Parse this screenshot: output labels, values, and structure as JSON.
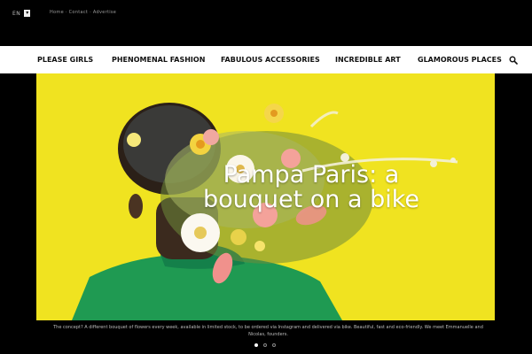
{
  "topbar": {
    "language": "EN",
    "language_toggle": "▾",
    "links": "Home · Contact · Advertise"
  },
  "nav": {
    "items": [
      {
        "label": "PLEASE GIRLS"
      },
      {
        "label": "PHENOMENAL FASHION"
      },
      {
        "label": "FABULOUS ACCESSORIES"
      },
      {
        "label": "INCREDIBLE ART"
      },
      {
        "label": "GLAMOROUS PLACES"
      }
    ],
    "search_icon": "search-icon"
  },
  "hero": {
    "title": "Pampa Paris: a bouquet on a bike",
    "caption": "The concept? A different bouquet of flowers every week, available in limited stock, to be ordered via Instagram and delivered via bike. Beautiful, fast and eco-friendly. We meet Emmanuelle and Nicolas, founders."
  },
  "slider": {
    "dots": 3,
    "active_index": 0
  },
  "colors": {
    "background": "#000000",
    "nav_bg": "#ffffff",
    "hero_yellow": "#f0e320",
    "shirt_green": "#1f9a52"
  }
}
